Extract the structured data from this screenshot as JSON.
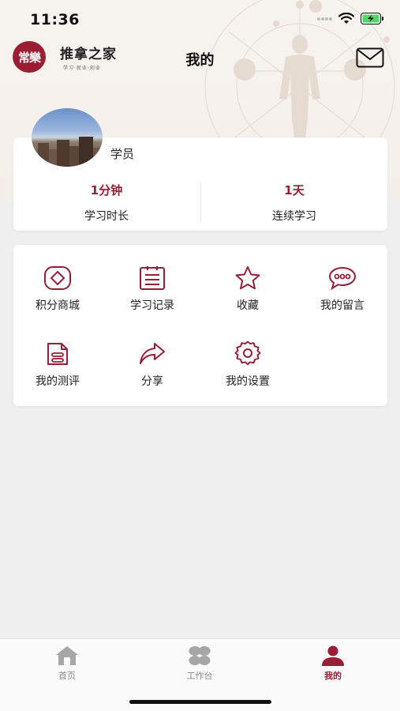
{
  "status_bar": {
    "time": "11:36"
  },
  "brand": {
    "logo_text": "常樂",
    "name": "推拿之家",
    "slogan": "学习·就业·创业"
  },
  "header": {
    "title": "我的"
  },
  "profile": {
    "name": "学员",
    "stats": [
      {
        "value": "1分钟",
        "label": "学习时长"
      },
      {
        "value": "1天",
        "label": "连续学习"
      }
    ]
  },
  "menu": {
    "items": [
      {
        "label": "积分商城",
        "icon": "diamond-icon"
      },
      {
        "label": "学习记录",
        "icon": "notepad-icon"
      },
      {
        "label": "收藏",
        "icon": "star-icon"
      },
      {
        "label": "我的留言",
        "icon": "chat-bubble-icon"
      },
      {
        "label": "我的测评",
        "icon": "document-icon"
      },
      {
        "label": "分享",
        "icon": "share-arrow-icon"
      },
      {
        "label": "我的设置",
        "icon": "gear-icon"
      }
    ]
  },
  "tab_bar": {
    "tabs": [
      {
        "label": "首页",
        "icon": "home-icon",
        "active": false
      },
      {
        "label": "工作台",
        "icon": "workbench-icon",
        "active": false
      },
      {
        "label": "我的",
        "icon": "person-icon",
        "active": true
      }
    ]
  },
  "colors": {
    "accent": "#9a1d33",
    "background": "#efefef",
    "card": "#ffffff"
  }
}
